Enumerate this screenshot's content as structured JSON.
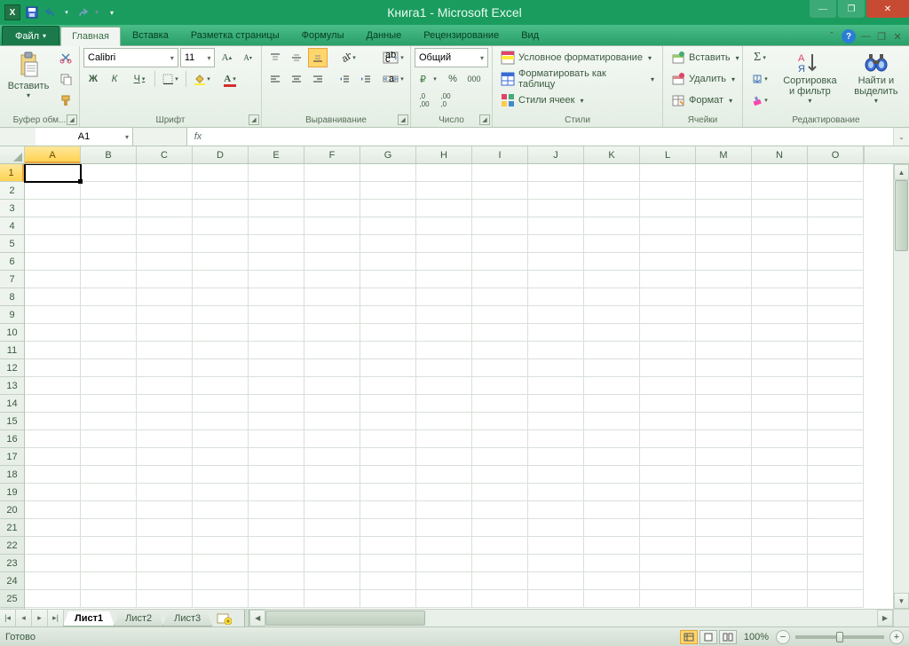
{
  "title": "Книга1 - Microsoft Excel",
  "tabs": {
    "file": "Файл",
    "items": [
      "Главная",
      "Вставка",
      "Разметка страницы",
      "Формулы",
      "Данные",
      "Рецензирование",
      "Вид"
    ],
    "active": 0
  },
  "ribbon": {
    "clipboard": {
      "label": "Буфер обм...",
      "paste": "Вставить"
    },
    "font": {
      "label": "Шрифт",
      "name": "Calibri",
      "size": "11",
      "bold": "Ж",
      "italic": "К",
      "underline": "Ч"
    },
    "alignment": {
      "label": "Выравнивание"
    },
    "number": {
      "label": "Число",
      "format": "Общий"
    },
    "styles": {
      "label": "Стили",
      "cond": "Условное форматирование",
      "table": "Форматировать как таблицу",
      "cell": "Стили ячеек"
    },
    "cells": {
      "label": "Ячейки",
      "insert": "Вставить",
      "delete": "Удалить",
      "format": "Формат"
    },
    "editing": {
      "label": "Редактирование",
      "sort": "Сортировка и фильтр",
      "find": "Найти и выделить"
    }
  },
  "name_box": "A1",
  "fx_label": "fx",
  "columns": [
    "A",
    "B",
    "C",
    "D",
    "E",
    "F",
    "G",
    "H",
    "I",
    "J",
    "K",
    "L",
    "M",
    "N",
    "O"
  ],
  "active_col": 0,
  "rows": 25,
  "active_row": 0,
  "selected_cell": "A1",
  "sheets": {
    "items": [
      "Лист1",
      "Лист2",
      "Лист3"
    ],
    "active": 0
  },
  "status": {
    "ready": "Готово",
    "zoom": "100%"
  }
}
